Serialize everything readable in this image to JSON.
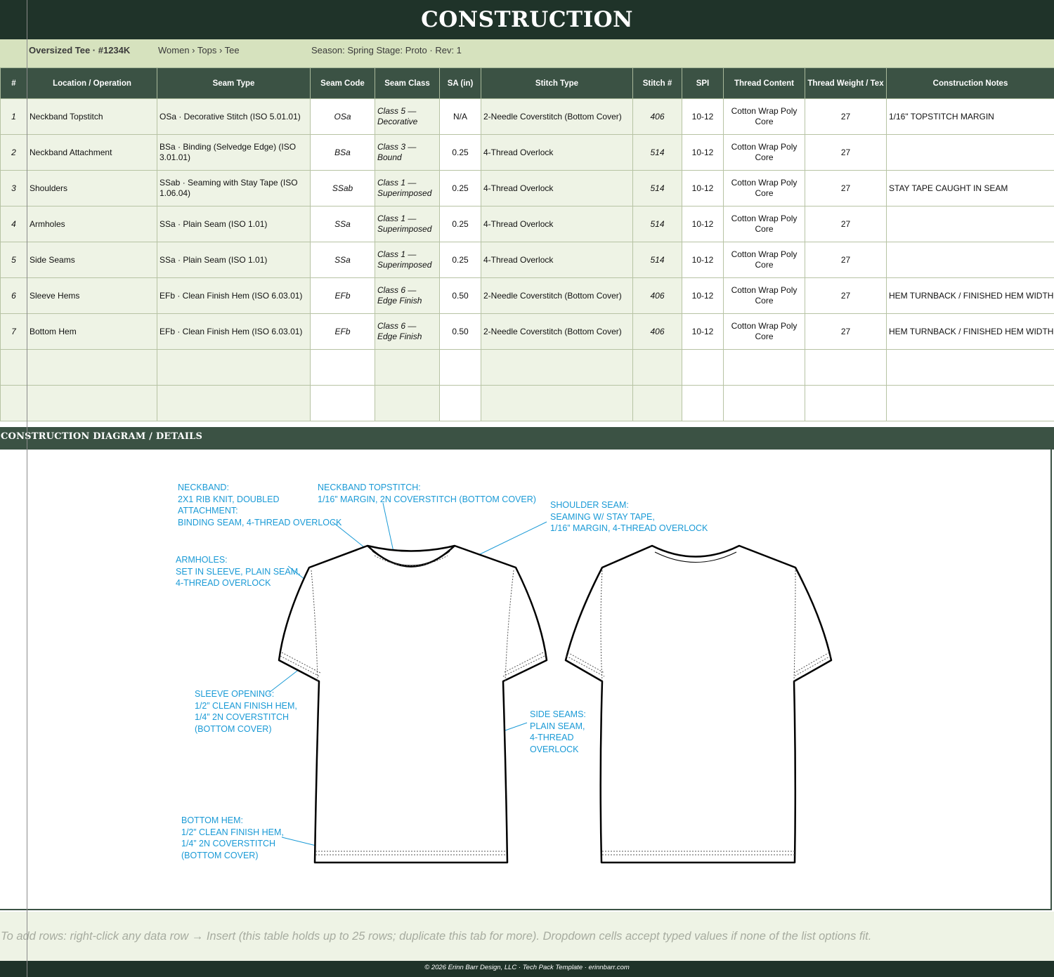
{
  "title": "CONSTRUCTION",
  "meta": {
    "style": "Oversized Tee  ·  #1234K",
    "breadcrumb": "Women › Tops › Tee",
    "season_stage": "Season: Spring Stage: Proto  ·  Rev: 1"
  },
  "table": {
    "headers": {
      "num": "#",
      "location": "Location / Operation",
      "seam_type": "Seam Type",
      "seam_code": "Seam Code",
      "seam_class": "Seam Class",
      "sa": "SA (in)",
      "stitch_type": "Stitch Type",
      "stitch_num": "Stitch #",
      "spi": "SPI",
      "thread_content": "Thread Content",
      "thread_weight": "Thread Weight / Tex",
      "notes": "Construction Notes"
    },
    "rows": [
      {
        "num": "1",
        "location": "Neckband Topstitch",
        "seam_type": "OSa · Decorative Stitch (ISO 5.01.01)",
        "seam_code": "OSa",
        "seam_class": "Class 5 — Decorative",
        "sa": "N/A",
        "stitch_type": "2-Needle Coverstitch (Bottom Cover)",
        "stitch_num": "406",
        "spi": "10-12",
        "thread_content": "Cotton Wrap Poly Core",
        "thread_weight": "27",
        "notes": "1/16\" TOPSTITCH MARGIN"
      },
      {
        "num": "2",
        "location": "Neckband Attachment",
        "seam_type": "BSa · Binding (Selvedge Edge) (ISO 3.01.01)",
        "seam_code": "BSa",
        "seam_class": "Class 3 — Bound",
        "sa": "0.25",
        "stitch_type": "4-Thread Overlock",
        "stitch_num": "514",
        "spi": "10-12",
        "thread_content": "Cotton Wrap Poly Core",
        "thread_weight": "27",
        "notes": ""
      },
      {
        "num": "3",
        "location": "Shoulders",
        "seam_type": "SSab · Seaming with Stay Tape (ISO 1.06.04)",
        "seam_code": "SSab",
        "seam_class": "Class 1 — Superimposed",
        "sa": "0.25",
        "stitch_type": "4-Thread Overlock",
        "stitch_num": "514",
        "spi": "10-12",
        "thread_content": "Cotton Wrap Poly Core",
        "thread_weight": "27",
        "notes": "STAY TAPE CAUGHT IN SEAM"
      },
      {
        "num": "4",
        "location": "Armholes",
        "seam_type": "SSa · Plain Seam (ISO 1.01)",
        "seam_code": "SSa",
        "seam_class": "Class 1 — Superimposed",
        "sa": "0.25",
        "stitch_type": "4-Thread Overlock",
        "stitch_num": "514",
        "spi": "10-12",
        "thread_content": "Cotton Wrap Poly Core",
        "thread_weight": "27",
        "notes": ""
      },
      {
        "num": "5",
        "location": "Side Seams",
        "seam_type": "SSa · Plain Seam (ISO 1.01)",
        "seam_code": "SSa",
        "seam_class": "Class 1 — Superimposed",
        "sa": "0.25",
        "stitch_type": "4-Thread Overlock",
        "stitch_num": "514",
        "spi": "10-12",
        "thread_content": "Cotton Wrap Poly Core",
        "thread_weight": "27",
        "notes": ""
      },
      {
        "num": "6",
        "location": "Sleeve Hems",
        "seam_type": "EFb · Clean Finish Hem (ISO 6.03.01)",
        "seam_code": "EFb",
        "seam_class": "Class 6 — Edge Finish",
        "sa": "0.50",
        "stitch_type": "2-Needle Coverstitch (Bottom Cover)",
        "stitch_num": "406",
        "spi": "10-12",
        "thread_content": "Cotton Wrap Poly Core",
        "thread_weight": "27",
        "notes": "HEM TURNBACK / FINISHED HEM WIDTH"
      },
      {
        "num": "7",
        "location": "Bottom Hem",
        "seam_type": "EFb · Clean Finish Hem (ISO 6.03.01)",
        "seam_code": "EFb",
        "seam_class": "Class 6 — Edge Finish",
        "sa": "0.50",
        "stitch_type": "2-Needle Coverstitch (Bottom Cover)",
        "stitch_num": "406",
        "spi": "10-12",
        "thread_content": "Cotton Wrap Poly Core",
        "thread_weight": "27",
        "notes": "HEM TURNBACK / FINISHED HEM WIDTH"
      }
    ]
  },
  "diagram": {
    "heading": "CONSTRUCTION DIAGRAM / DETAILS",
    "callouts": {
      "neckband": "NECKBAND:\n2X1 RIB KNIT, DOUBLED\nATTACHMENT:\nBINDING SEAM, 4-THREAD OVERLOCK",
      "neckband_topstitch": "NECKBAND TOPSTITCH:\n1/16” MARGIN, 2N COVERSTITCH (BOTTOM COVER)",
      "shoulder": "SHOULDER SEAM:\nSEAMING W/ STAY TAPE,\n1/16” MARGIN, 4-THREAD OVERLOCK",
      "armholes": "ARMHOLES:\nSET IN SLEEVE, PLAIN SEAM,\n4-THREAD OVERLOCK",
      "sleeve_opening": "SLEEVE OPENING:\n1/2” CLEAN FINISH HEM,\n1/4” 2N COVERSTITCH\n(BOTTOM COVER)",
      "side_seams": "SIDE SEAMS:\nPLAIN SEAM,\n4-THREAD\nOVERLOCK",
      "bottom_hem": "BOTTOM HEM:\n1/2” CLEAN FINISH HEM,\n1/4” 2N COVERSTITCH\n(BOTTOM COVER)"
    },
    "callout_color": "#1a9ad6"
  },
  "footer_note": "To add rows: right-click any data row → Insert (this table holds up to 25 rows; duplicate this tab for more). Dropdown cells accept typed values if none of the list options fit.",
  "copyright": "© 2026 Erinn Barr Design, LLC  ·  Tech Pack Template  ·  erinnbarr.com",
  "colors": {
    "header_dark": "#1f3329",
    "header_green": "#3b5244",
    "meta_band": "#d6e2be",
    "row_fill": "#eef3e5"
  }
}
